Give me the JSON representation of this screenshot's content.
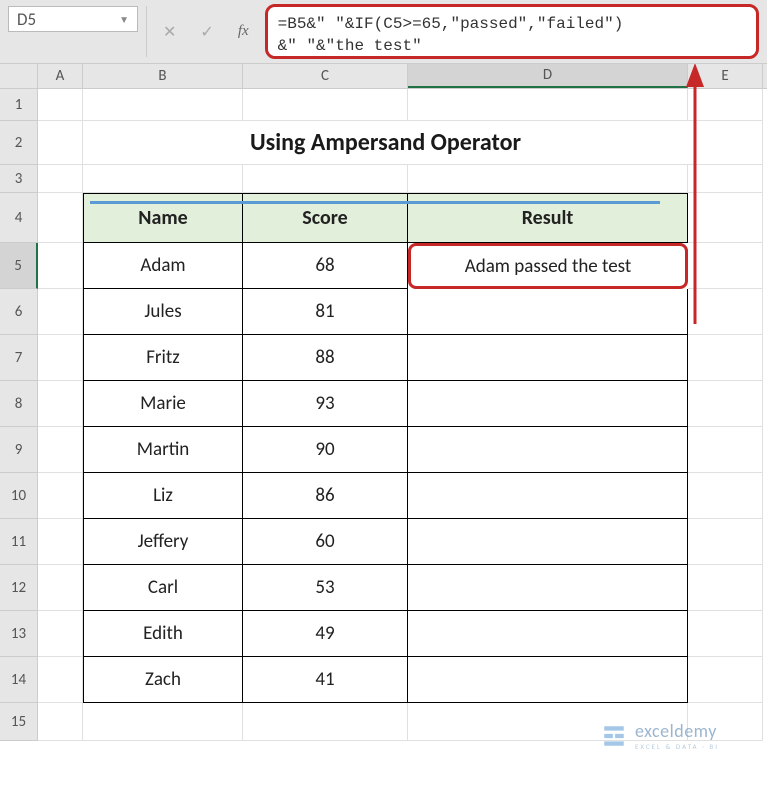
{
  "nameBox": "D5",
  "formula_line1": "=B5&\" \"&IF(C5>=65,\"passed\",\"failed\")",
  "formula_line2": "&\" \"&\"the test\"",
  "columns": {
    "A": "A",
    "B": "B",
    "C": "C",
    "D": "D",
    "E": "E"
  },
  "rows": [
    "1",
    "2",
    "3",
    "4",
    "5",
    "6",
    "7",
    "8",
    "9",
    "10",
    "11",
    "12",
    "13",
    "14",
    "15"
  ],
  "title": "Using Ampersand Operator",
  "headers": {
    "name": "Name",
    "score": "Score",
    "result": "Result"
  },
  "data": [
    {
      "name": "Adam",
      "score": "68",
      "result": "Adam passed the test"
    },
    {
      "name": "Jules",
      "score": "81",
      "result": ""
    },
    {
      "name": "Fritz",
      "score": "88",
      "result": ""
    },
    {
      "name": "Marie",
      "score": "93",
      "result": ""
    },
    {
      "name": "Martin",
      "score": "90",
      "result": ""
    },
    {
      "name": "Liz",
      "score": "86",
      "result": ""
    },
    {
      "name": "Jeffery",
      "score": "60",
      "result": ""
    },
    {
      "name": "Carl",
      "score": "53",
      "result": ""
    },
    {
      "name": "Edith",
      "score": "49",
      "result": ""
    },
    {
      "name": "Zach",
      "score": "41",
      "result": ""
    }
  ],
  "watermark": {
    "brand": "exceldemy",
    "tagline": "EXCEL & DATA · BI"
  }
}
